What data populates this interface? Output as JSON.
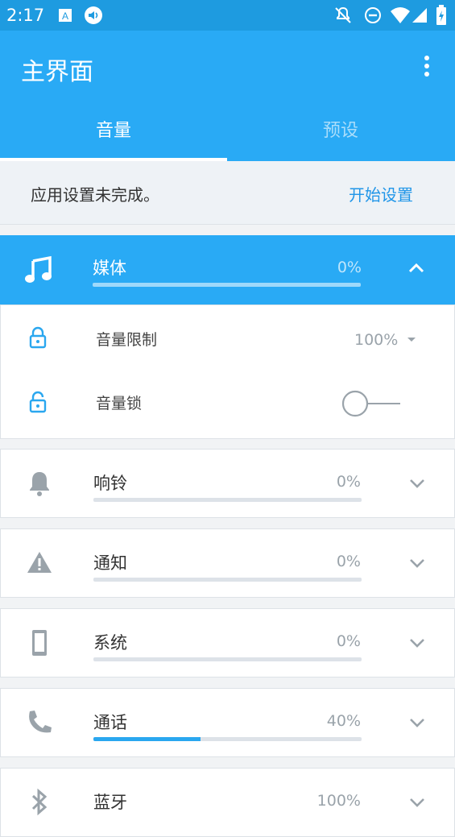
{
  "status_bar": {
    "time": "2:17"
  },
  "app_bar": {
    "title": "主界面"
  },
  "tabs": [
    {
      "label": "音量",
      "active": true
    },
    {
      "label": "预设",
      "active": false
    }
  ],
  "notice": {
    "message": "应用设置未完成。",
    "action": "开始设置"
  },
  "media": {
    "name": "媒体",
    "percent": "0%",
    "level": 0,
    "options": [
      {
        "label": "音量限制",
        "value": "100%"
      },
      {
        "label": "音量锁"
      }
    ]
  },
  "channels": [
    {
      "name": "响铃",
      "percent": "0%",
      "level": 0,
      "icon": "bell-icon"
    },
    {
      "name": "通知",
      "percent": "0%",
      "level": 0,
      "icon": "warning-icon"
    },
    {
      "name": "系统",
      "percent": "0%",
      "level": 0,
      "icon": "phone-device-icon"
    },
    {
      "name": "通话",
      "percent": "40%",
      "level": 0.4,
      "icon": "call-icon"
    },
    {
      "name": "蓝牙",
      "percent": "100%",
      "level": 1.0,
      "icon": "bluetooth-icon"
    }
  ],
  "colors": {
    "primary": "#29aaf5",
    "status_bar": "#1e9be0",
    "accent_link": "#2196e8"
  }
}
